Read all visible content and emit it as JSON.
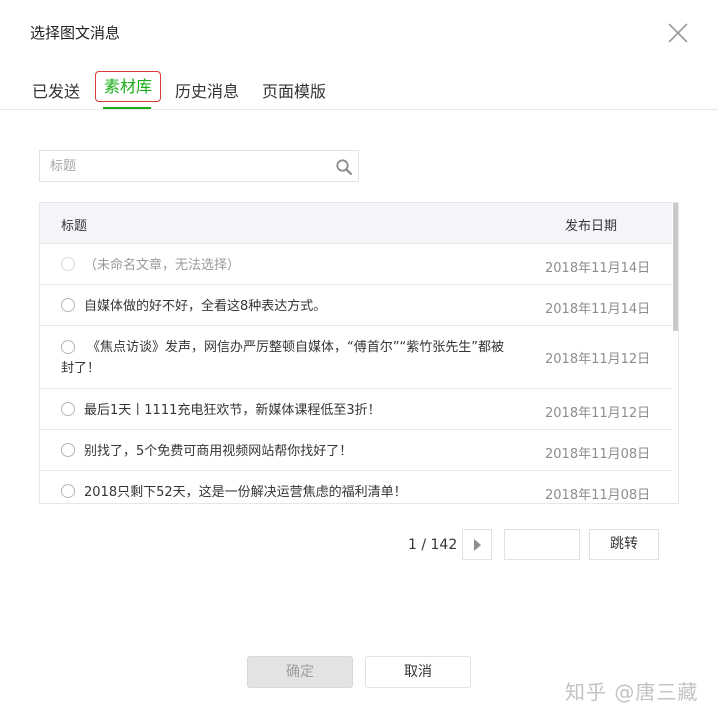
{
  "dialog": {
    "title": "选择图文消息",
    "close_icon": "close-icon"
  },
  "tabs": [
    {
      "label": "已发送",
      "active": false
    },
    {
      "label": "素材库",
      "active": true
    },
    {
      "label": "历史消息",
      "active": false
    },
    {
      "label": "页面模版",
      "active": false
    }
  ],
  "colors": {
    "accent": "#1aad19",
    "active_tab_border": "#d93a3a",
    "header_bg": "#f4f5f9",
    "border": "#e7e7eb"
  },
  "search": {
    "placeholder": "标题",
    "value": "",
    "icon": "search-icon"
  },
  "table": {
    "columns": [
      "标题",
      "发布日期"
    ],
    "rows": [
      {
        "title": "（未命名文章，无法选择）",
        "date": "2018年11月14日",
        "disabled": true
      },
      {
        "title": "自媒体做的好不好，全看这8种表达方式。",
        "date": "2018年11月14日",
        "disabled": false
      },
      {
        "title": "《焦点访谈》发声，网信办严厉整顿自媒体，“傅首尔”“紫竹张先生”都被封了！",
        "date": "2018年11月12日",
        "disabled": false
      },
      {
        "title": "最后1天丨1111充电狂欢节，新媒体课程低至3折！",
        "date": "2018年11月12日",
        "disabled": false
      },
      {
        "title": "别找了，5个免费可商用视频网站帮你找好了！",
        "date": "2018年11月08日",
        "disabled": false
      },
      {
        "title": "2018只剩下52天，这是一份解决运营焦虑的福利清单！",
        "date": "2018年11月08日",
        "disabled": false
      }
    ]
  },
  "pager": {
    "text": "1 / 142",
    "next_icon": "triangle-right-icon",
    "jump_value": "",
    "jump_label": "跳转"
  },
  "footer": {
    "ok_label": "确定",
    "cancel_label": "取消"
  },
  "watermark": "知乎 @唐三藏"
}
